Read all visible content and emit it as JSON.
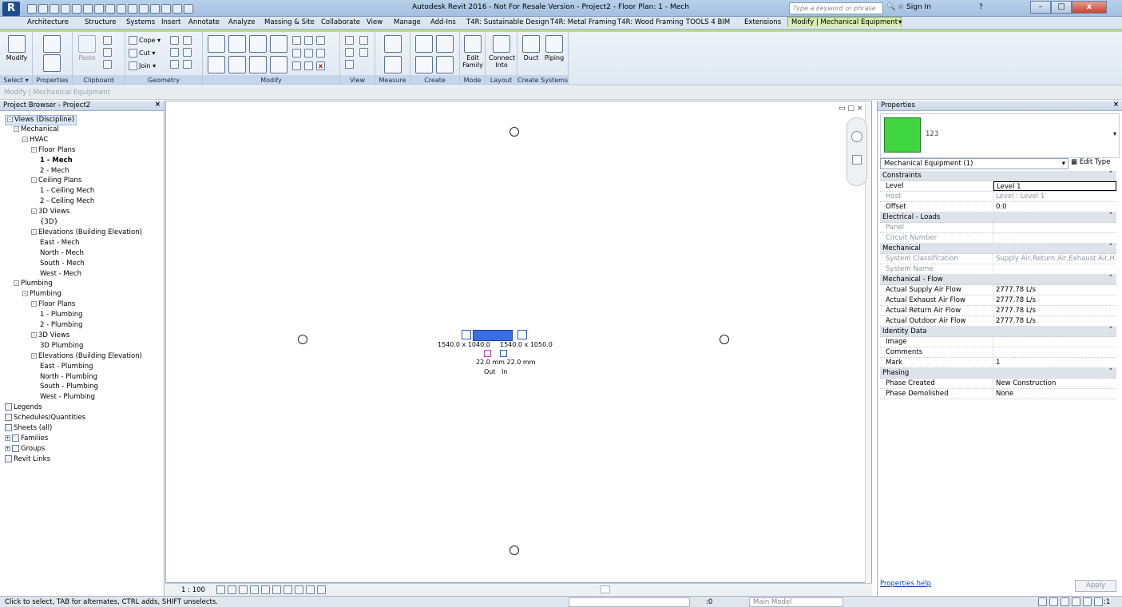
{
  "app": {
    "logo": "R",
    "title": "Autodesk Revit 2016 - Not For Resale Version -   Project2 - Floor Plan: 1 - Mech",
    "search_placeholder": "Type a keyword or phrase",
    "signin": "Sign In",
    "help": "?"
  },
  "window_buttons": {
    "minimize": "–",
    "restore": "□",
    "close": "x"
  },
  "tabs": [
    "Architecture",
    "Structure",
    "Systems",
    "Insert",
    "Annotate",
    "Analyze",
    "Massing & Site",
    "Collaborate",
    "View",
    "Manage",
    "Add-Ins",
    "T4R: Sustainable Design",
    "T4R: Metal Framing",
    "T4R: Wood Framing",
    "TOOLS 4 BIM",
    "Extensions",
    "Modify | Mechanical Equipment"
  ],
  "ribbon": {
    "modify_label": "Modify",
    "panels": [
      "Select ▾",
      "Properties",
      "Clipboard",
      "Geometry",
      "Modify",
      "View",
      "Measure",
      "Create",
      "Mode",
      "Layout",
      "Create Systems"
    ],
    "paste": "Paste",
    "cope": "Cope ▾",
    "cut": "Cut ▾",
    "join": "Join ▾",
    "edit_family": "Edit Family",
    "connect_into": "Connect Into",
    "duct": "Duct",
    "piping": "Piping"
  },
  "context_bar": "Modify | Mechanical Equipment",
  "project_browser": {
    "title": "Project Browser - Project2",
    "items": [
      {
        "label": "Views (Discipline)",
        "level": 0,
        "exp": "-"
      },
      {
        "label": "Mechanical",
        "level": 1,
        "exp": "-"
      },
      {
        "label": "HVAC",
        "level": 2,
        "exp": "-"
      },
      {
        "label": "Floor Plans",
        "level": 3,
        "exp": "-"
      },
      {
        "label": "1 - Mech",
        "level": 4,
        "bold": true
      },
      {
        "label": "2 - Mech",
        "level": 4
      },
      {
        "label": "Ceiling Plans",
        "level": 3,
        "exp": "-"
      },
      {
        "label": "1 - Ceiling Mech",
        "level": 4
      },
      {
        "label": "2 - Ceiling Mech",
        "level": 4
      },
      {
        "label": "3D Views",
        "level": 3,
        "exp": "-"
      },
      {
        "label": "{3D}",
        "level": 4
      },
      {
        "label": "Elevations (Building Elevation)",
        "level": 3,
        "exp": "-"
      },
      {
        "label": "East - Mech",
        "level": 4
      },
      {
        "label": "North - Mech",
        "level": 4
      },
      {
        "label": "South - Mech",
        "level": 4
      },
      {
        "label": "West - Mech",
        "level": 4
      },
      {
        "label": "Plumbing",
        "level": 1,
        "exp": "-"
      },
      {
        "label": "Plumbing",
        "level": 2,
        "exp": "-"
      },
      {
        "label": "Floor Plans",
        "level": 3,
        "exp": "-"
      },
      {
        "label": "1 - Plumbing",
        "level": 4
      },
      {
        "label": "2 - Plumbing",
        "level": 4
      },
      {
        "label": "3D Views",
        "level": 3,
        "exp": "-"
      },
      {
        "label": "3D Plumbing",
        "level": 4
      },
      {
        "label": "Elevations (Building Elevation)",
        "level": 3,
        "exp": "-"
      },
      {
        "label": "East - Plumbing",
        "level": 4
      },
      {
        "label": "North - Plumbing",
        "level": 4
      },
      {
        "label": "South - Plumbing",
        "level": 4
      },
      {
        "label": "West - Plumbing",
        "level": 4
      },
      {
        "label": "Legends",
        "level": 0,
        "icon": true
      },
      {
        "label": "Schedules/Quantities",
        "level": 0,
        "icon": true
      },
      {
        "label": "Sheets (all)",
        "level": 0,
        "icon": true
      },
      {
        "label": "Families",
        "level": 0,
        "exp": "+",
        "icon": true
      },
      {
        "label": "Groups",
        "level": 0,
        "exp": "+",
        "icon": true
      },
      {
        "label": "Revit Links",
        "level": 0,
        "icon": true
      }
    ]
  },
  "canvas": {
    "dim_left": "1540.0 x 1040.0",
    "dim_right": "1540.0 x 1050.0",
    "dim_bottom": "22.0 mm 22.0 mm",
    "out": "Out",
    "in": "In",
    "scale": "1 : 100"
  },
  "properties": {
    "title": "Properties",
    "type_name": "123",
    "selector": "Mechanical Equipment (1)",
    "edit_type": "Edit Type",
    "rows": [
      {
        "cat": "Constraints"
      },
      {
        "k": "Level",
        "v": "Level 1",
        "edit": true
      },
      {
        "k": "Host",
        "v": "Level : Level 1",
        "dis": true
      },
      {
        "k": "Offset",
        "v": "0.0"
      },
      {
        "cat": "Electrical - Loads"
      },
      {
        "k": "Panel",
        "v": "",
        "dis": true
      },
      {
        "k": "Circuit Number",
        "v": "",
        "dis": true
      },
      {
        "cat": "Mechanical"
      },
      {
        "k": "System Classification",
        "v": "Supply Air,Return Air,Exhaust Air,H...",
        "dis": true
      },
      {
        "k": "System Name",
        "v": "",
        "dis": true
      },
      {
        "cat": "Mechanical - Flow"
      },
      {
        "k": "Actual Supply Air Flow",
        "v": "2777.78 L/s"
      },
      {
        "k": "Actual Exhaust Air Flow",
        "v": "2777.78 L/s"
      },
      {
        "k": "Actual Return Air Flow",
        "v": "2777.78 L/s"
      },
      {
        "k": "Actual Outdoor Air Flow",
        "v": "2777.78 L/s"
      },
      {
        "cat": "Identity Data"
      },
      {
        "k": "Image",
        "v": ""
      },
      {
        "k": "Comments",
        "v": ""
      },
      {
        "k": "Mark",
        "v": "1"
      },
      {
        "cat": "Phasing"
      },
      {
        "k": "Phase Created",
        "v": "New Construction"
      },
      {
        "k": "Phase Demolished",
        "v": "None"
      }
    ],
    "help": "Properties help",
    "apply": "Apply"
  },
  "status": {
    "message": "Click to select, TAB for alternates, CTRL adds, SHIFT unselects.",
    "workset": ":0",
    "model": "Main Model",
    "filter": ":1"
  }
}
